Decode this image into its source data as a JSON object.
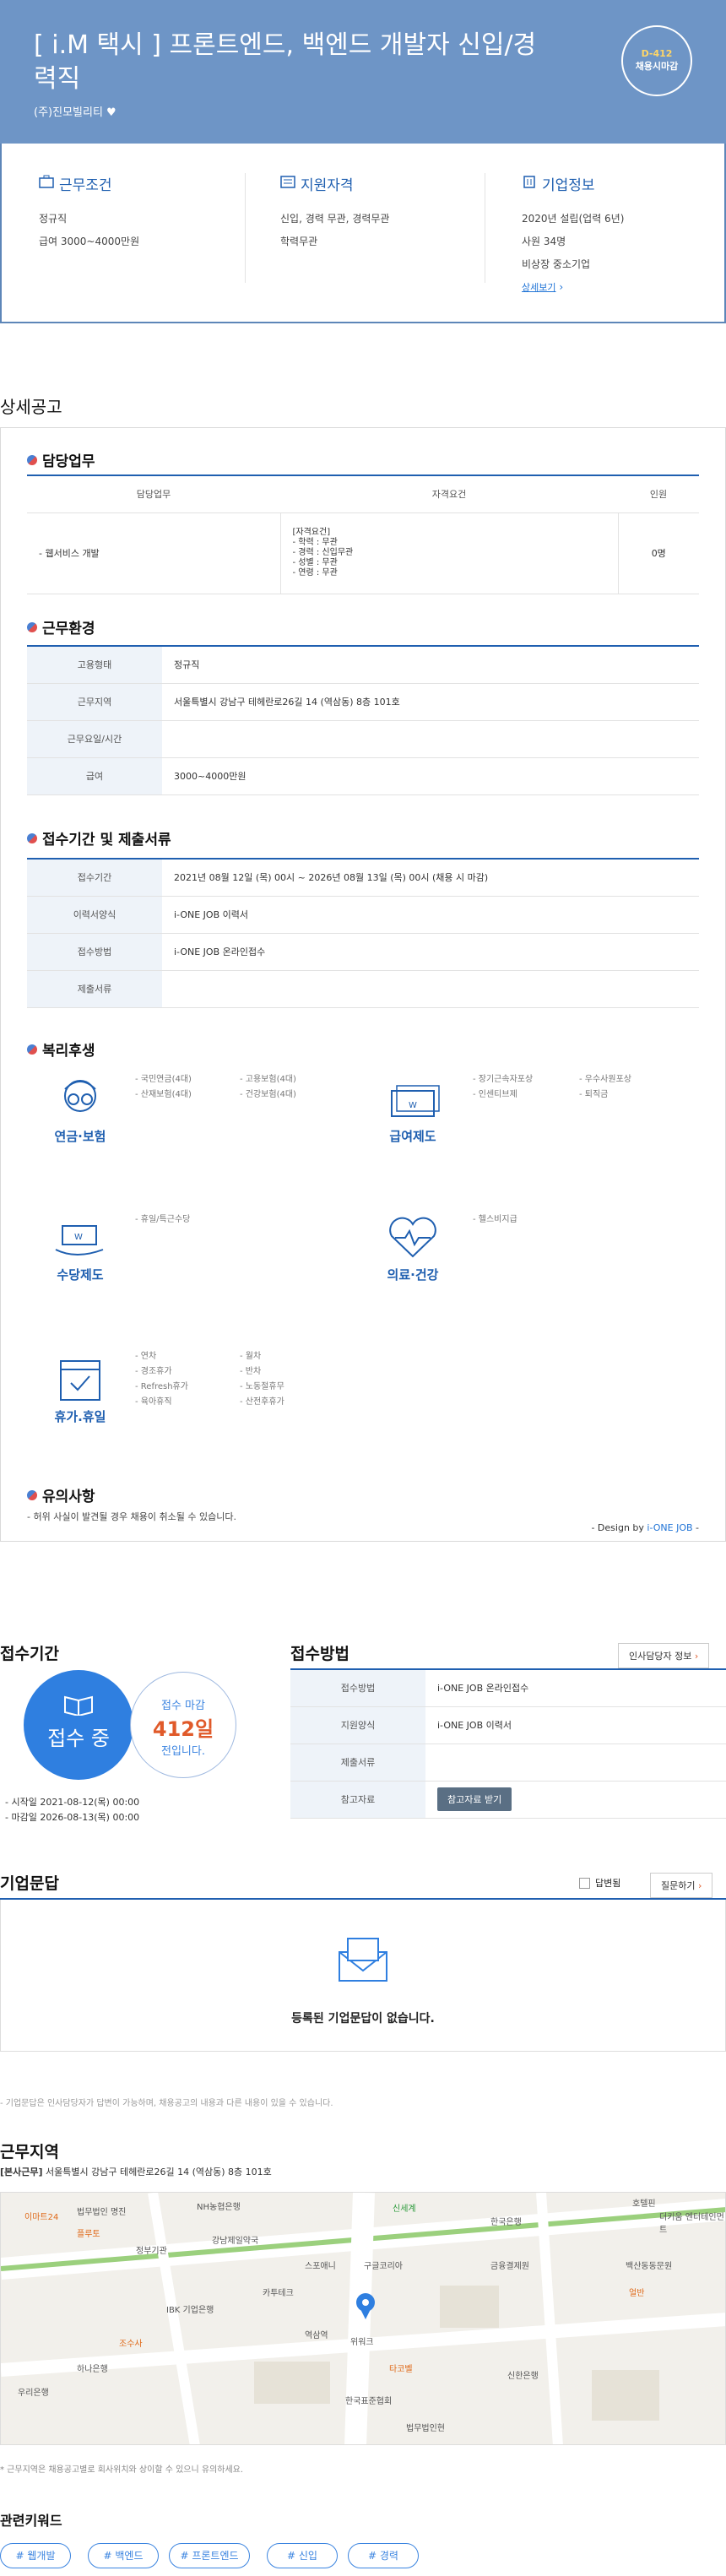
{
  "header": {
    "title": "[ i.M 택시 ] 프론트엔드, 백엔드 개발자 신입/경력직",
    "company": "(주)진모빌리티",
    "dday": "D-412",
    "dday_sub": "채용시마감"
  },
  "summary": {
    "conditions": {
      "title": "근무조건",
      "items": [
        "정규직",
        "급여 3000~4000만원"
      ]
    },
    "qualification": {
      "title": "지원자격",
      "items": [
        "신입, 경력 무관, 경력무관",
        "학력무관"
      ]
    },
    "company": {
      "title": "기업정보",
      "items": [
        "2020년 설립(업력 6년)",
        "사원 34명",
        "비상장 중소기업"
      ],
      "more": "상세보기"
    }
  },
  "detail_title": "상세공고",
  "duty": {
    "title": "담당업무",
    "headers": [
      "담당업무",
      "자격요건",
      "인원"
    ],
    "row": {
      "task": "- 웹서비스 개발",
      "req": [
        "[자격요건]",
        "- 학력 : 무관",
        "- 경력 : 신입무관",
        "- 성별 : 무관",
        "- 연령 : 무관"
      ],
      "count": "0명"
    }
  },
  "env": {
    "title": "근무환경",
    "rows": [
      {
        "k": "고용형태",
        "v": "정규직"
      },
      {
        "k": "근무지역",
        "v": "서울특별시 강남구 테헤란로26길 14 (역삼동) 8층 101호"
      },
      {
        "k": "근무요일/시간",
        "v": ""
      },
      {
        "k": "급여",
        "v": "3000~4000만원"
      }
    ]
  },
  "apply_info": {
    "title": "접수기간 및 제출서류",
    "rows": [
      {
        "k": "접수기간",
        "v": "2021년 08월 12일 (목) 00시 ~ 2026년 08월 13일 (목) 00시 (채용 시 마감)"
      },
      {
        "k": "이력서양식",
        "v": "i-ONE JOB 이력서"
      },
      {
        "k": "접수방법",
        "v": "i-ONE JOB 온라인접수"
      },
      {
        "k": "제출서류",
        "v": ""
      }
    ]
  },
  "welfare": {
    "title": "복리후생",
    "pension": {
      "label": "연금·보험",
      "a": [
        "- 국민연금(4대)",
        "- 산재보험(4대)"
      ],
      "b": [
        "- 고용보험(4대)",
        "- 건강보험(4대)"
      ]
    },
    "salary": {
      "label": "급여제도",
      "a": [
        "- 장기근속자포상",
        "- 인센티브제"
      ],
      "b": [
        "- 우수사원포상",
        "- 퇴직금"
      ]
    },
    "allowance": {
      "label": "수당제도",
      "a": [
        "- 휴일/특근수당"
      ]
    },
    "medical": {
      "label": "의료·건강",
      "a": [
        "- 헬스비지급"
      ]
    },
    "vacation": {
      "label": "휴가.휴일",
      "a": [
        "- 연차",
        "- 경조휴가",
        "- Refresh휴가",
        "- 육아휴직"
      ],
      "b": [
        "- 월차",
        "- 반차",
        "- 노동절휴무",
        "- 산전후휴가"
      ]
    }
  },
  "notice": {
    "title": "유의사항",
    "text": "- 허위 사실이 발견될 경우 채용이 취소될 수 있습니다."
  },
  "design": {
    "prefix": "- Design by ",
    "brand": "i-ONE JOB",
    "suffix": " -"
  },
  "period": {
    "title": "접수기간",
    "status": "접수 중",
    "left_label": "접수 마감",
    "days": "412일",
    "left_suffix": "전입니다.",
    "start": "시작일 2021-08-12(목) 00:00",
    "end": "마감일 2026-08-13(목) 00:00"
  },
  "method": {
    "title": "접수방법",
    "contact_btn": "인사담당자 정보",
    "rows": [
      {
        "k": "접수방법",
        "v": "i-ONE JOB 온라인접수"
      },
      {
        "k": "지원양식",
        "v": "i-ONE JOB 이력서"
      },
      {
        "k": "제출서류",
        "v": ""
      },
      {
        "k": "참고자료",
        "v": ""
      }
    ],
    "ref_btn": "참고자료 받기"
  },
  "qa": {
    "title": "기업문답",
    "check": "답변됨",
    "ask": "질문하기",
    "empty": "등록된 기업문답이 없습니다.",
    "note": "- 기업문답은 인사담당자가 답변이 가능하며, 채용공고의 내용과 다른 내용이 있을 수 있습니다."
  },
  "location": {
    "title": "근무지역",
    "tag": "[본사근무]",
    "addr": "서울특별시 강남구 테헤란로26길 14 (역삼동) 8층 101호",
    "note": "* 근무지역은 채용공고별로 회사위치와 상이할 수 있으니 유의하세요.",
    "map_labels": [
      "NH농협은행",
      "호텔핀",
      "법무법인 명진",
      "강남제일약국",
      "한국은행",
      "더키움 엔터테인먼트",
      "이마트24",
      "플루토",
      "카투테크",
      "구글코리아",
      "금융결제원",
      "백산동동문원",
      "신세계",
      "IBK 기업은행",
      "조수사",
      "정부기관",
      "스포애니",
      "위워크",
      "우리은행",
      "신한은행",
      "하나은행",
      "역삼역",
      "한국표준협회",
      "법무법인현",
      "타코벨",
      "얼반"
    ]
  },
  "keywords": {
    "title": "관련키워드",
    "items": [
      "# 웹개발",
      "# 백엔드",
      "# 프론트엔드",
      "# 신입",
      "# 경력"
    ]
  }
}
